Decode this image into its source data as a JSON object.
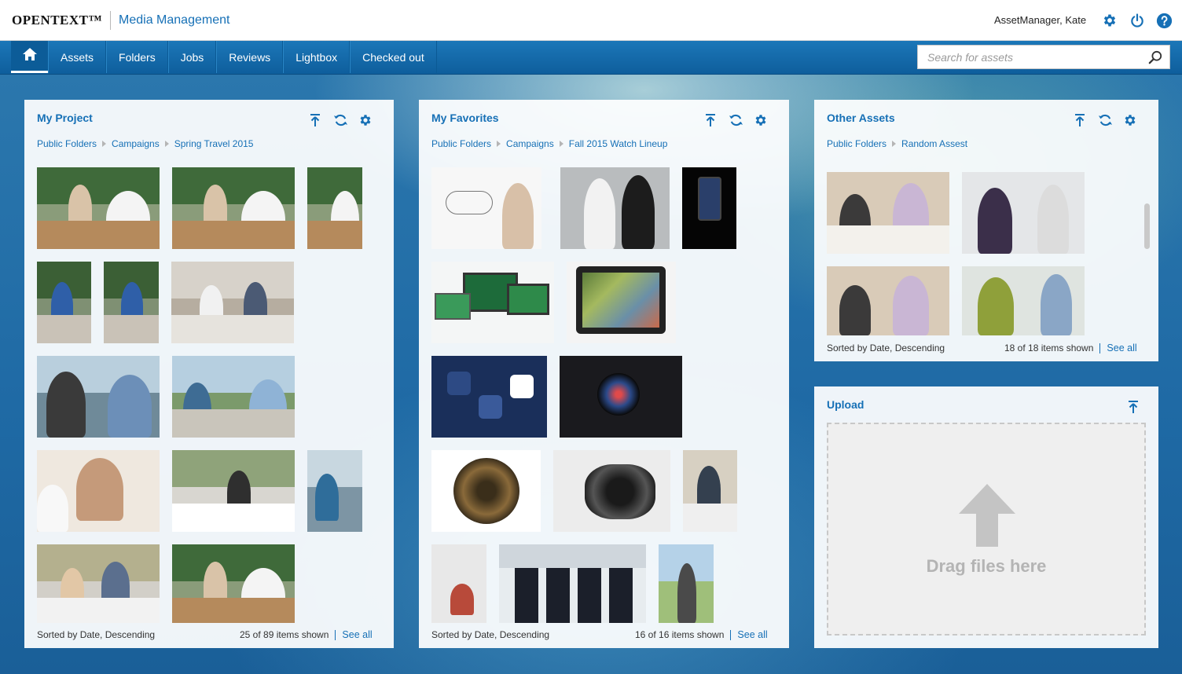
{
  "header": {
    "brand": "OPENTEXT™",
    "product": "Media Management",
    "user": "AssetManager, Kate",
    "icons": [
      "gear-icon",
      "power-icon",
      "help-icon"
    ]
  },
  "nav": {
    "items": [
      "Assets",
      "Folders",
      "Jobs",
      "Reviews",
      "Lightbox",
      "Checked out"
    ],
    "search_placeholder": "Search for assets"
  },
  "panels": {
    "my_project": {
      "title": "My Project",
      "breadcrumb": [
        "Public Folders",
        "Campaigns",
        "Spring Travel 2015"
      ],
      "sort": "Sorted by Date, Descending",
      "count": "25 of 89 items shown",
      "see_all": "See all"
    },
    "my_favorites": {
      "title": "My Favorites",
      "breadcrumb": [
        "Public Folders",
        "Campaigns",
        "Fall 2015 Watch Lineup"
      ],
      "sort": "Sorted by Date, Descending",
      "count": "16 of 16 items shown",
      "see_all": "See all"
    },
    "other_assets": {
      "title": "Other Assets",
      "breadcrumb": [
        "Public Folders",
        "Random Assest"
      ],
      "sort": "Sorted by Date, Descending",
      "count": "18 of 18 items shown",
      "see_all": "See all"
    },
    "upload": {
      "title": "Upload",
      "drop_text": "Drag files here"
    }
  },
  "colors": {
    "accent": "#1670b6",
    "nav": "#1c77b8",
    "nav_active": "#0c5c98"
  }
}
